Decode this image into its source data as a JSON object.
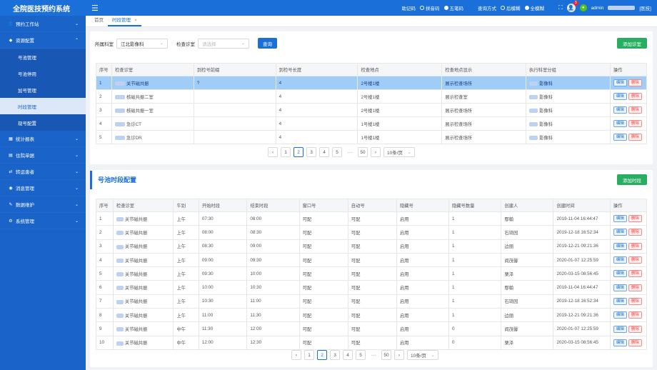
{
  "app": {
    "title": "全院医技预约系统"
  },
  "topbar": {
    "mnemonic_label": "助记码",
    "opt_pinyin": "拼音码",
    "opt_wubi": "五笔码",
    "query_label": "查询方式",
    "opt_back": "后模糊",
    "opt_full": "全模糊",
    "notif_count": "3",
    "user": "admin",
    "user_suffix": "[医技]"
  },
  "sidebar": {
    "items": [
      {
        "label": "预约工作站",
        "icon": "user-icon",
        "open": false
      },
      {
        "label": "资源配置",
        "icon": "shield-icon",
        "open": true,
        "children": [
          "号池管理",
          "号池停用",
          "加号管理",
          "时段管理",
          "现号配置"
        ],
        "active": "时段管理"
      },
      {
        "label": "统计报表",
        "icon": "chart-icon",
        "open": false
      },
      {
        "label": "住院单据",
        "icon": "doc-icon",
        "open": false
      },
      {
        "label": "转运患者",
        "icon": "transfer-icon",
        "open": false
      },
      {
        "label": "消息管理",
        "icon": "bell-icon",
        "open": false
      },
      {
        "label": "数据维护",
        "icon": "wrench-icon",
        "open": false
      },
      {
        "label": "系统管理",
        "icon": "gear-icon",
        "open": false
      }
    ]
  },
  "tabs": [
    {
      "label": "首页",
      "active": false
    },
    {
      "label": "时段管理",
      "active": true
    }
  ],
  "filters": {
    "dept_label": "所属科室",
    "dept_value": "江北影像科",
    "room_label": "检查诊室",
    "room_placeholder": "请选择",
    "search_btn": "查询"
  },
  "add_room_btn": "添加诊室",
  "room_table": {
    "headers": [
      "序号",
      "检查诊室",
      "到检号前缀",
      "到检号长度",
      "检查地点",
      "检查地点显示",
      "执行科室分组",
      "操作"
    ],
    "rows": [
      {
        "no": "1",
        "room": "关节磁共振",
        "prefix": "?",
        "length": "4",
        "place": "2号楼1楼",
        "display": "展示检查场所",
        "group": "影像科",
        "selected": true
      },
      {
        "no": "2",
        "room": "核磁共振二室",
        "prefix": "",
        "length": "4",
        "place": "2号楼1楼",
        "display": "展示检查室",
        "group": "影像科",
        "selected": false
      },
      {
        "no": "3",
        "room": "核磁共振一室",
        "prefix": "",
        "length": "4",
        "place": "2号楼1楼",
        "display": "展示检查场所",
        "group": "影像科",
        "selected": false
      },
      {
        "no": "4",
        "room": "急诊CT",
        "prefix": "",
        "length": "4",
        "place": "1号楼1楼",
        "display": "展示检查场所",
        "group": "影像科",
        "selected": false
      },
      {
        "no": "5",
        "room": "急诊DR",
        "prefix": "",
        "length": "4",
        "place": "1号楼1楼",
        "display": "展示检查场所",
        "group": "影像科",
        "selected": false
      }
    ]
  },
  "actions": {
    "edit": "编辑",
    "delete": "删除"
  },
  "pager1": {
    "pages": [
      "1",
      "2",
      "3",
      "4",
      "5"
    ],
    "active": "2",
    "last": "50",
    "size": "10条/页"
  },
  "section2": {
    "title": "号池时段配置",
    "add_btn": "添加时段"
  },
  "slot_table": {
    "headers": [
      "序号",
      "检查诊室",
      "午别",
      "开始时段",
      "结束时段",
      "窗口号",
      "自动号",
      "隐藏号",
      "隐藏号数量",
      "创建人",
      "创建时间",
      "操作"
    ],
    "rows": [
      {
        "no": "1",
        "room": "关节磁共振",
        "ampm": "上午",
        "start": "07:30",
        "end": "08:00",
        "window": "可配",
        "auto": "可配",
        "hide": "启用",
        "hidden_count": "1",
        "creator": "鄢翰",
        "created": "2019-11-04 16:44:47"
      },
      {
        "no": "2",
        "room": "关节磁共振",
        "ampm": "上午",
        "start": "08:00",
        "end": "08:30",
        "window": "可配",
        "auto": "可配",
        "hide": "启用",
        "hidden_count": "1",
        "creator": "石琦园",
        "created": "2019-12-18 16:52:34"
      },
      {
        "no": "3",
        "room": "关节磁共振",
        "ampm": "上午",
        "start": "08:30",
        "end": "09:00",
        "window": "可配",
        "auto": "可配",
        "hide": "启用",
        "hidden_count": "1",
        "creator": "边丽",
        "created": "2019-12-21 09:21:36"
      },
      {
        "no": "4",
        "room": "关节磁共振",
        "ampm": "上午",
        "start": "09:00",
        "end": "09:30",
        "window": "可配",
        "auto": "可配",
        "hide": "启用",
        "hidden_count": "1",
        "creator": "阎茂馨",
        "created": "2020-01-07 12:25:59"
      },
      {
        "no": "5",
        "room": "关节磁共振",
        "ampm": "上午",
        "start": "09:30",
        "end": "10:00",
        "window": "可配",
        "auto": "可配",
        "hide": "启用",
        "hidden_count": "1",
        "creator": "栗泽",
        "created": "2020-03-15 08:56:45"
      },
      {
        "no": "6",
        "room": "关节磁共振",
        "ampm": "上午",
        "start": "10:00",
        "end": "10:30",
        "window": "可配",
        "auto": "可配",
        "hide": "启用",
        "hidden_count": "1",
        "creator": "鄢翰",
        "created": "2019-11-04 16:44:47"
      },
      {
        "no": "7",
        "room": "关节磁共振",
        "ampm": "上午",
        "start": "10:30",
        "end": "11:00",
        "window": "可配",
        "auto": "可配",
        "hide": "启用",
        "hidden_count": "1",
        "creator": "石琦园",
        "created": "2019-12-18 16:52:34"
      },
      {
        "no": "8",
        "room": "关节磁共振",
        "ampm": "上午",
        "start": "11:00",
        "end": "11:30",
        "window": "可配",
        "auto": "可配",
        "hide": "启用",
        "hidden_count": "1",
        "creator": "边丽",
        "created": "2019-12-21 09:21:36"
      },
      {
        "no": "9",
        "room": "关节磁共振",
        "ampm": "中午",
        "start": "11:30",
        "end": "12:00",
        "window": "可配",
        "auto": "可配",
        "hide": "启用",
        "hidden_count": "0",
        "creator": "阎茂馨",
        "created": "2020-01-07 12:25:59"
      },
      {
        "no": "10",
        "room": "关节磁共振",
        "ampm": "中午",
        "start": "12:00",
        "end": "12:30",
        "window": "可配",
        "auto": "可配",
        "hide": "启用",
        "hidden_count": "0",
        "creator": "栗泽",
        "created": "2020-03-15 08:56:45"
      }
    ]
  },
  "pager2": {
    "pages": [
      "1",
      "2",
      "3",
      "4",
      "5"
    ],
    "active": "2",
    "last": "50",
    "size": "10条/页"
  },
  "colors": {
    "primary": "#1a6fd8",
    "sidebar": "#1a63c8",
    "green": "#27ae60",
    "selected_row": "#9fcdf7"
  }
}
